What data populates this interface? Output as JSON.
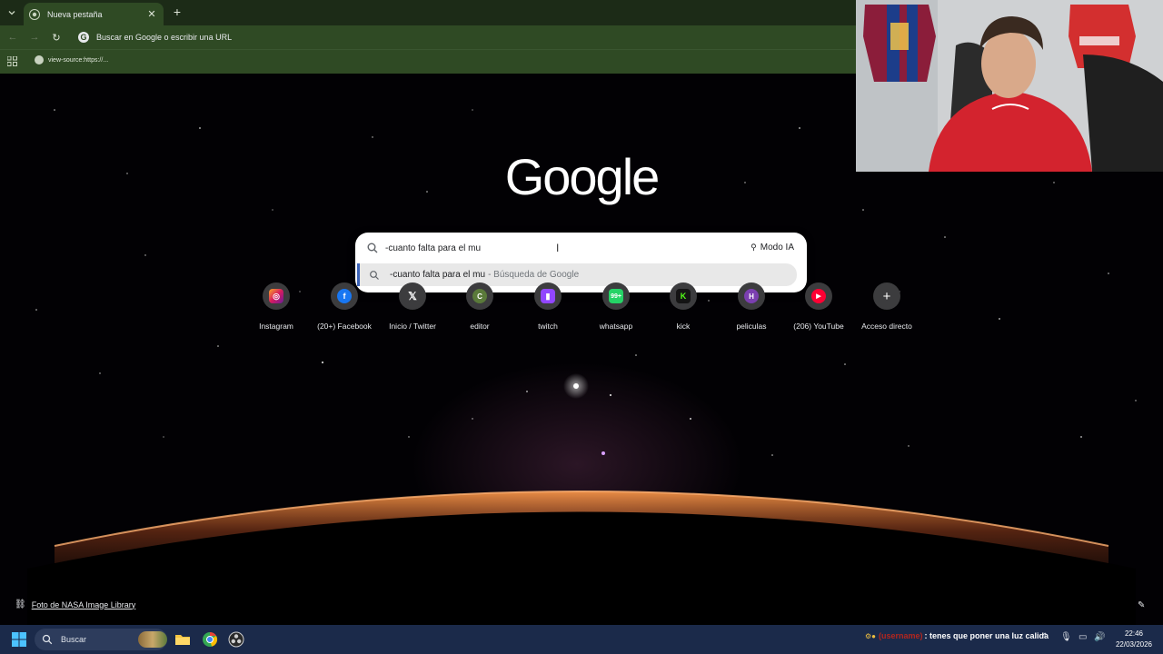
{
  "browser": {
    "tab": {
      "title": "Nueva pestaña"
    },
    "omnibox": {
      "placeholder": "Buscar en Google o escribir una URL"
    },
    "bookmarks": [
      {
        "label": "view-source:https://..."
      }
    ]
  },
  "ntp": {
    "logo": "Google",
    "search": {
      "query": "-cuanto falta para el mu",
      "ai_mode_label": "Modo IA",
      "suggestion": {
        "text": "-cuanto falta para el mu",
        "sub": "- Búsqueda de Google"
      }
    },
    "shortcuts": [
      {
        "label": "Instagram",
        "icon": "instagram-icon"
      },
      {
        "label": "(20+) Facebook",
        "icon": "facebook-icon"
      },
      {
        "label": "Inicio / Twitter",
        "icon": "x-icon"
      },
      {
        "label": "editor",
        "icon": "letter-c-icon"
      },
      {
        "label": "twitch",
        "icon": "twitch-icon"
      },
      {
        "label": "whatsapp",
        "icon": "whatsapp-icon"
      },
      {
        "label": "kick",
        "icon": "kick-icon"
      },
      {
        "label": "peliculas",
        "icon": "letter-h-icon"
      },
      {
        "label": "(206) YouTube",
        "icon": "youtube-icon"
      },
      {
        "label": "Acceso directo",
        "icon": "plus-icon"
      }
    ],
    "credit": "Foto de NASA Image Library"
  },
  "taskbar": {
    "search_label": "Buscar",
    "chat": {
      "user": "(username)",
      "message": ": tenes que poner una luz calida"
    },
    "clock": {
      "time": "22:46",
      "date": "22/03/2026"
    }
  },
  "colors": {
    "chrome_frame": "#1c2b17",
    "chrome_toolbar": "#2f4a24",
    "taskbar": "#1b2a4a",
    "suggestion_accent": "#3b63b8"
  }
}
